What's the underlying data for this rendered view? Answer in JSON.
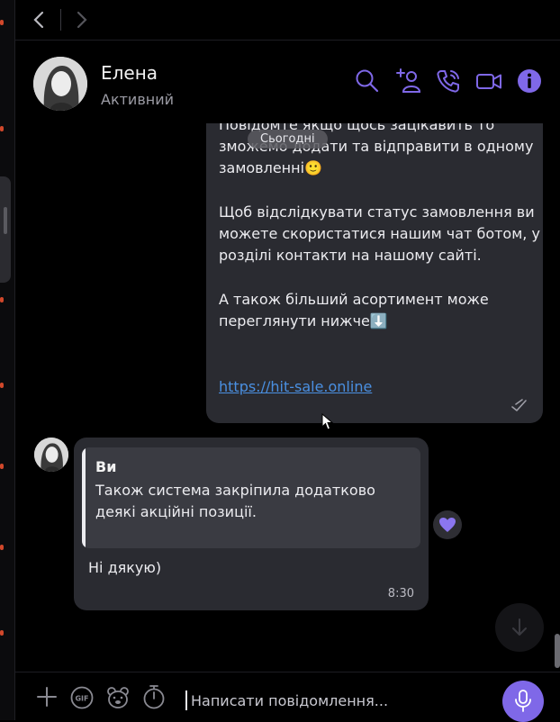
{
  "header": {
    "contact_name": "Елена",
    "contact_status": "Активний"
  },
  "chat": {
    "date_separator": "Сьогодні",
    "outgoing": {
      "paragraph1": "Повідомте якщо щось зацікавить то\nзможемо додати та відправити в одному\nзамовленні🙂",
      "paragraph2": "Щоб відслідкувати статус замовлення ви\nможете скористатися нашим чат ботом, у\nрозділі контакти на нашому сайті.",
      "paragraph3": "А також більший асортимент може\nпереглянути  нижче⬇️",
      "link": "https://hit-sale.online"
    },
    "incoming": {
      "quote_author": "Ви",
      "quote_text": "Також система закріпила додатково деякі акційні позиції.",
      "text": "Ні дякую)",
      "time": "8:30"
    }
  },
  "composer": {
    "placeholder": "Написати повідомлення..."
  },
  "colors": {
    "accent": "#7f68e8",
    "bubble": "#2a2b31",
    "link": "#4a90e2"
  }
}
